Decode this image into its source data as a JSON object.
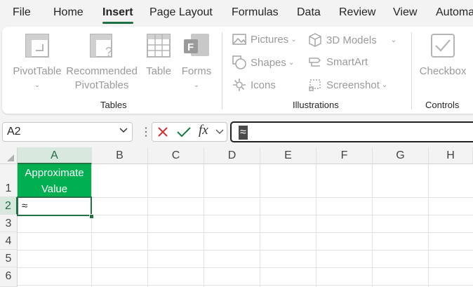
{
  "tabs": [
    "File",
    "Home",
    "Insert",
    "Page Layout",
    "Formulas",
    "Data",
    "Review",
    "View",
    "Automa"
  ],
  "active_tab": "Insert",
  "ribbon": {
    "tables": {
      "pivot_table": "PivotTable",
      "recommended_line1": "Recommended",
      "recommended_line2": "PivotTables",
      "table": "Table",
      "forms": "Forms",
      "group_label": "Tables"
    },
    "illustrations": {
      "pictures": "Pictures",
      "shapes": "Shapes",
      "icons": "Icons",
      "models": "3D Models",
      "smartart": "SmartArt",
      "screenshot": "Screenshot",
      "group_label": "Illustrations"
    },
    "controls": {
      "checkbox": "Checkbox",
      "group_label": "Controls"
    }
  },
  "formula_bar": {
    "name_box": "A2",
    "fx": "fx",
    "content": "≈"
  },
  "grid": {
    "columns": [
      "A",
      "B",
      "C",
      "D",
      "E",
      "F",
      "G",
      "H"
    ],
    "rows": [
      "1",
      "2",
      "3",
      "4",
      "5",
      "6"
    ],
    "selected_column": "A",
    "selected_row": "2",
    "a1_line1": "Approximate",
    "a1_line2": "Value",
    "a2": "≈",
    "header_fill": "#00b050",
    "accent": "#217346"
  }
}
